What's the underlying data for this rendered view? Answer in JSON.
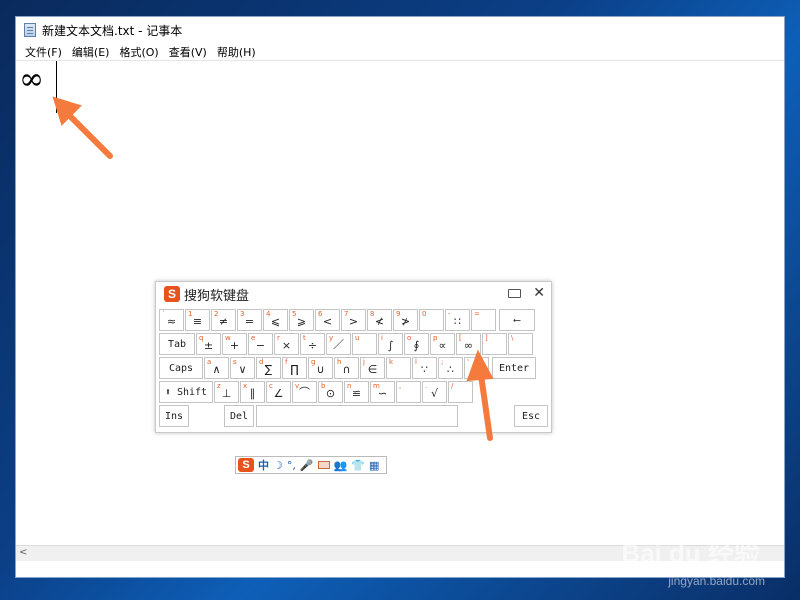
{
  "window": {
    "title": "新建文本文档.txt - 记事本"
  },
  "menu": [
    "文件(F)",
    "编辑(E)",
    "格式(O)",
    "查看(V)",
    "帮助(H)"
  ],
  "editor": {
    "content": "∞"
  },
  "soft_keyboard": {
    "title": "搜狗软键盘",
    "rows": [
      [
        {
          "top": "`",
          "main": "≈"
        },
        {
          "top": "1",
          "main": "≡"
        },
        {
          "top": "2",
          "main": "≠"
        },
        {
          "top": "3",
          "main": "="
        },
        {
          "top": "4",
          "main": "⩽"
        },
        {
          "top": "5",
          "main": "⩾"
        },
        {
          "top": "6",
          "main": "<"
        },
        {
          "top": "7",
          "main": ">"
        },
        {
          "top": "8",
          "main": "≮"
        },
        {
          "top": "9",
          "main": "≯"
        },
        {
          "top": "0",
          "main": ""
        },
        {
          "top": "-",
          "main": "∷"
        },
        {
          "top": "=",
          "main": ""
        }
      ],
      [
        {
          "top": "q",
          "main": "±"
        },
        {
          "top": "w",
          "main": "+"
        },
        {
          "top": "e",
          "main": "−"
        },
        {
          "top": "r",
          "main": "×"
        },
        {
          "top": "t",
          "main": "÷"
        },
        {
          "top": "y",
          "main": "／"
        },
        {
          "top": "u",
          "main": ""
        },
        {
          "top": "i",
          "main": "∫"
        },
        {
          "top": "o",
          "main": "∮"
        },
        {
          "top": "p",
          "main": "∝"
        },
        {
          "top": "[",
          "main": "∞"
        },
        {
          "top": "]",
          "main": ""
        },
        {
          "top": "\\",
          "main": ""
        }
      ],
      [
        {
          "top": "a",
          "main": "∧"
        },
        {
          "top": "s",
          "main": "∨"
        },
        {
          "top": "d",
          "main": "∑"
        },
        {
          "top": "f",
          "main": "∏"
        },
        {
          "top": "g",
          "main": "∪"
        },
        {
          "top": "h",
          "main": "∩"
        },
        {
          "top": "j",
          "main": "∈"
        },
        {
          "top": "k",
          "main": ""
        },
        {
          "top": "l",
          "main": "∵"
        },
        {
          "top": ";",
          "main": "∴"
        },
        {
          "top": "'",
          "main": ""
        }
      ],
      [
        {
          "top": "z",
          "main": "⊥"
        },
        {
          "top": "x",
          "main": "∥"
        },
        {
          "top": "c",
          "main": "∠"
        },
        {
          "top": "v",
          "main": "⌒"
        },
        {
          "top": "b",
          "main": "⊙"
        },
        {
          "top": "n",
          "main": "≌"
        },
        {
          "top": "m",
          "main": "∽"
        },
        {
          "top": ",",
          "main": ""
        },
        {
          "top": ".",
          "main": "√"
        },
        {
          "top": "/",
          "main": ""
        }
      ]
    ],
    "fn_keys": {
      "backspace": "⟵",
      "tab": "Tab",
      "caps": "Caps",
      "enter": "Enter",
      "shift": "⬆ Shift",
      "ins": "Ins",
      "del": "Del",
      "esc": "Esc"
    }
  },
  "ime_toolbar": {
    "logo": "S",
    "mode": "中"
  },
  "watermark": {
    "brand": "Bai du 经验",
    "url": "jingyan.baidu.com"
  },
  "colors": {
    "accent": "#f47a3d",
    "sogou": "#e8521c"
  }
}
